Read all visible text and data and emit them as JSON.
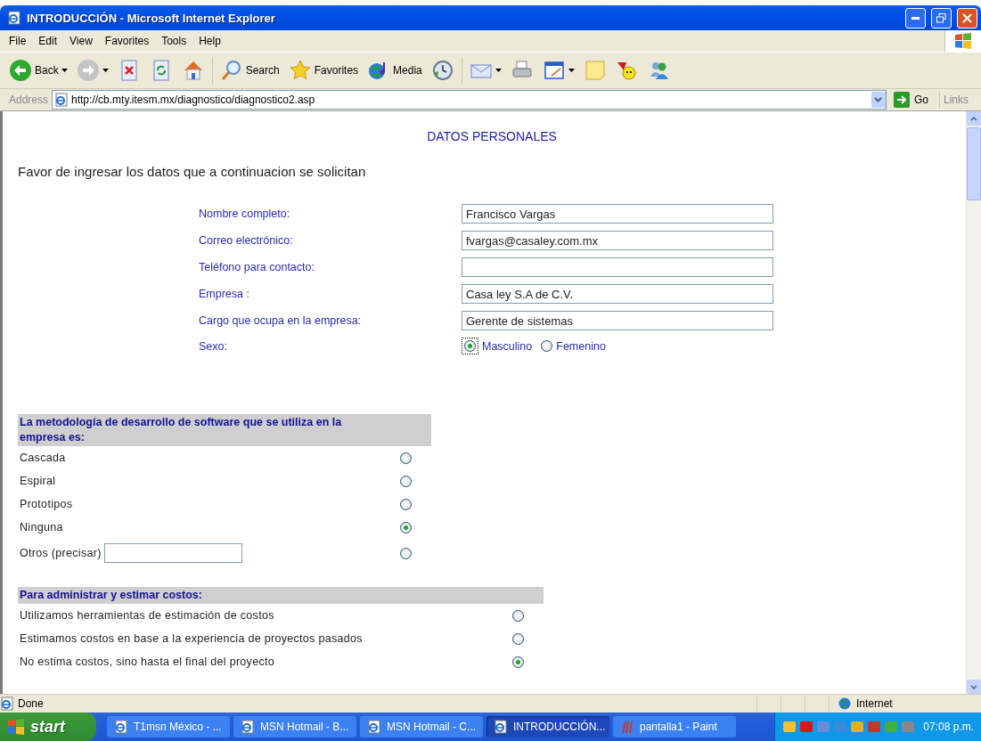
{
  "window": {
    "title": "INTRODUCCIÓN - Microsoft Internet Explorer"
  },
  "menu": [
    "File",
    "Edit",
    "View",
    "Favorites",
    "Tools",
    "Help"
  ],
  "toolbar": [
    {
      "kind": "back",
      "label": "Back"
    },
    {
      "kind": "forward"
    },
    {
      "kind": "stop"
    },
    {
      "kind": "refresh"
    },
    {
      "kind": "home"
    },
    {
      "kind": "search",
      "label": "Search"
    },
    {
      "kind": "favorites",
      "label": "Favorites"
    },
    {
      "kind": "media",
      "label": "Media"
    },
    {
      "kind": "history"
    },
    {
      "kind": "mail"
    },
    {
      "kind": "print"
    },
    {
      "kind": "edit"
    },
    {
      "kind": "note"
    },
    {
      "kind": "smiley"
    },
    {
      "kind": "people"
    }
  ],
  "address": {
    "label": "Address",
    "value": "http://cb.mty.itesm.mx/diagnostico/diagnostico2.asp",
    "go": "Go",
    "links": "Links"
  },
  "page": {
    "heading": "DATOS PERSONALES",
    "intro": "Favor de ingresar los datos que a continuacion se solicitan",
    "fields": [
      {
        "label": "Nombre completo:",
        "value": "Francisco Vargas"
      },
      {
        "label": "Correo electrónico:",
        "value": "fvargas@casaley.com.mx"
      },
      {
        "label": "Teléfono para contacto:"
      },
      {
        "label": "Empresa :",
        "value": "Casa ley S.A de C.V."
      },
      {
        "label": "Cargo que ocupa en la empresa:",
        "value": "Gerente de sistemas"
      }
    ],
    "sex": {
      "label": "Sexo:",
      "options": [
        {
          "label": "Masculino",
          "selected": true
        },
        {
          "label": "Femenino",
          "selected": false
        }
      ]
    },
    "sections": [
      {
        "title": "La metodología de desarrollo de software que se utiliza en la empresa es:",
        "options": [
          {
            "kind": "plain",
            "label": "Cascada",
            "selected": false
          },
          {
            "kind": "plain",
            "label": "Espiral",
            "selected": false
          },
          {
            "kind": "plain",
            "label": "Prototipos",
            "selected": false
          },
          {
            "kind": "plain",
            "label": "Ninguna",
            "selected": true
          },
          {
            "kind": "text",
            "label": "Otros (precisar)",
            "selected": false
          }
        ]
      },
      {
        "title": "Para administrar y estimar costos:",
        "options": [
          {
            "kind": "plain",
            "label": "Utilizamos herramientas de estimación de costos",
            "selected": false
          },
          {
            "kind": "plain",
            "label": "Estimamos costos en base a la experiencia de proyectos pasados",
            "selected": false
          },
          {
            "kind": "plain",
            "label": "No estima costos, sino hasta el final del proyecto",
            "selected": true
          }
        ]
      }
    ]
  },
  "status_bar": {
    "text": "Done",
    "zone": "Internet"
  },
  "taskbar": {
    "start": "start",
    "tasks": [
      {
        "label": "T1msn México - ...",
        "kind": "ie",
        "selected": false
      },
      {
        "label": "MSN Hotmail - B...",
        "kind": "ie",
        "selected": false
      },
      {
        "label": "MSN Hotmail - C...",
        "kind": "ie",
        "selected": false
      },
      {
        "label": "INTRODUCCIÓN...",
        "kind": "ie",
        "selected": true
      },
      {
        "label": "pantalla1 - Paint",
        "kind": "paint",
        "selected": false
      }
    ],
    "clock": "07:08 p.m."
  }
}
